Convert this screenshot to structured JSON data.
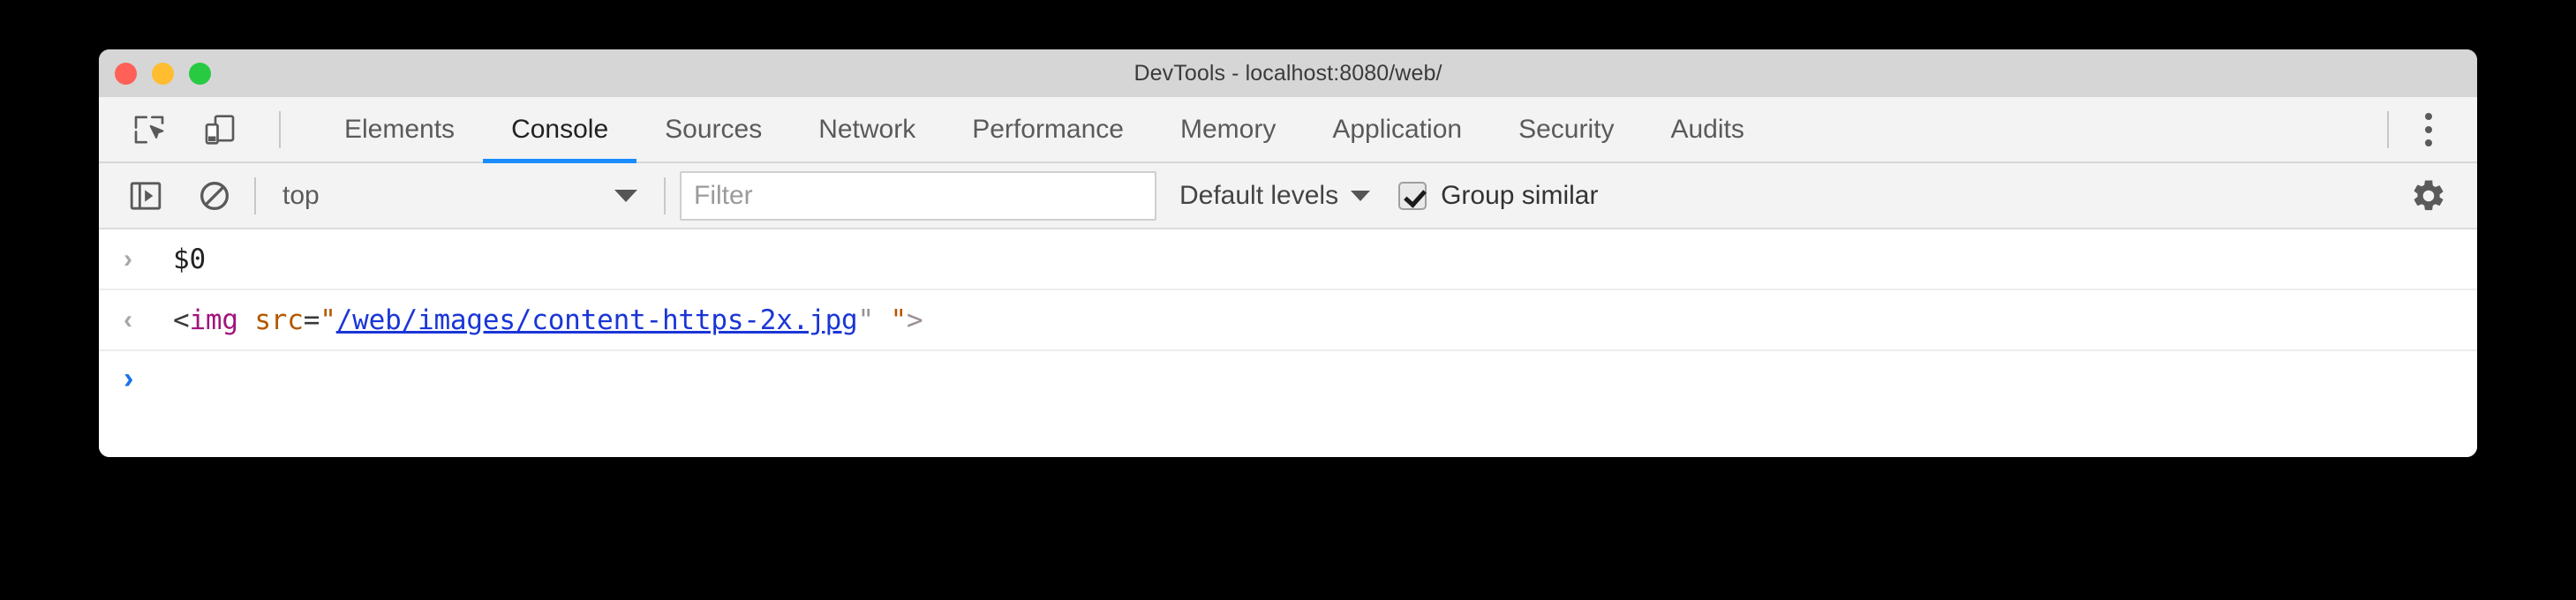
{
  "window": {
    "title": "DevTools - localhost:8080/web/",
    "traffic_lights": [
      {
        "name": "close",
        "color": "#ff6058"
      },
      {
        "name": "minimize",
        "color": "#ffbd2f"
      },
      {
        "name": "zoom",
        "color": "#28ca42"
      }
    ]
  },
  "tabbar": {
    "tools": [
      {
        "icon": "inspect-element-icon",
        "label": "Inspect element"
      },
      {
        "icon": "device-toolbar-icon",
        "label": "Toggle device toolbar"
      }
    ],
    "tabs": [
      {
        "label": "Elements",
        "active": false
      },
      {
        "label": "Console",
        "active": true
      },
      {
        "label": "Sources",
        "active": false
      },
      {
        "label": "Network",
        "active": false
      },
      {
        "label": "Performance",
        "active": false
      },
      {
        "label": "Memory",
        "active": false
      },
      {
        "label": "Application",
        "active": false
      },
      {
        "label": "Security",
        "active": false
      },
      {
        "label": "Audits",
        "active": false
      }
    ],
    "active_tab_underline_color": "#1a8cff",
    "more_menu": "more-options-icon"
  },
  "console_toolbar": {
    "sidebar_toggle": "console-sidebar-toggle-icon",
    "clear_console": "clear-console-icon",
    "context": {
      "selected": "top",
      "options": [
        "top"
      ]
    },
    "filter": {
      "value": "",
      "placeholder": "Filter"
    },
    "levels": {
      "selected": "Default levels",
      "options": [
        "Default levels"
      ]
    },
    "group_similar": {
      "label": "Group similar",
      "checked": true
    },
    "settings": "settings-gear-icon"
  },
  "console": {
    "rows": [
      {
        "marker": "input",
        "marker_glyph": "›",
        "text": "$0"
      },
      {
        "marker": "output",
        "marker_glyph": "‹",
        "tokens": {
          "open": "<",
          "tag": "img",
          "space": " ",
          "attr": "src",
          "equals": "=",
          "quote_open": "\"",
          "url": "/web/images/content-https-2x.jpg",
          "quote_close": "\"",
          "gap": " ",
          "quote_extra": "\"",
          "close": ">"
        },
        "plain": "<img src=\"/web/images/content-https-2x.jpg\" \">"
      },
      {
        "marker": "prompt",
        "marker_glyph": "›",
        "text": ""
      }
    ]
  }
}
